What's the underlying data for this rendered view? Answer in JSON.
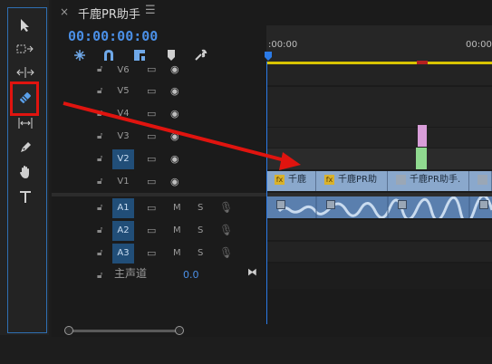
{
  "window": {
    "tab_close": "×",
    "tab_title": "千鹿PR助手",
    "tab_menu": "☰"
  },
  "timecode": "00:00:00:00",
  "ruler": {
    "start_label": ":00:00",
    "end_label": "00:00"
  },
  "tools": [
    "selection-tool",
    "track-select-tool",
    "ripple-edit-tool",
    "razor-tool",
    "slip-tool",
    "pen-tool",
    "hand-tool",
    "type-tool"
  ],
  "video_tracks": [
    {
      "label": "V6",
      "active": false
    },
    {
      "label": "V5",
      "active": false
    },
    {
      "label": "V4",
      "active": false
    },
    {
      "label": "V3",
      "active": false
    },
    {
      "label": "V2",
      "active": true
    },
    {
      "label": "V1",
      "active": false
    }
  ],
  "audio_tracks": [
    {
      "label": "A1",
      "m": "M",
      "s": "S"
    },
    {
      "label": "A2",
      "m": "M",
      "s": "S"
    },
    {
      "label": "A3",
      "m": "M",
      "s": "S"
    }
  ],
  "master": {
    "label": "主声道",
    "value": "0.0"
  },
  "clips": [
    {
      "fx": "fx",
      "label": "千鹿"
    },
    {
      "fx": "fx",
      "label": "千鹿PR助"
    },
    {
      "fx": "",
      "label": "千鹿PR助手."
    },
    {
      "fx": "",
      "label": ""
    }
  ],
  "colors": {
    "accent": "#4a8fe6",
    "highlight": "#e0140f",
    "clip_blue": "#8aa8cc",
    "audio_clip": "#5a7fae"
  }
}
